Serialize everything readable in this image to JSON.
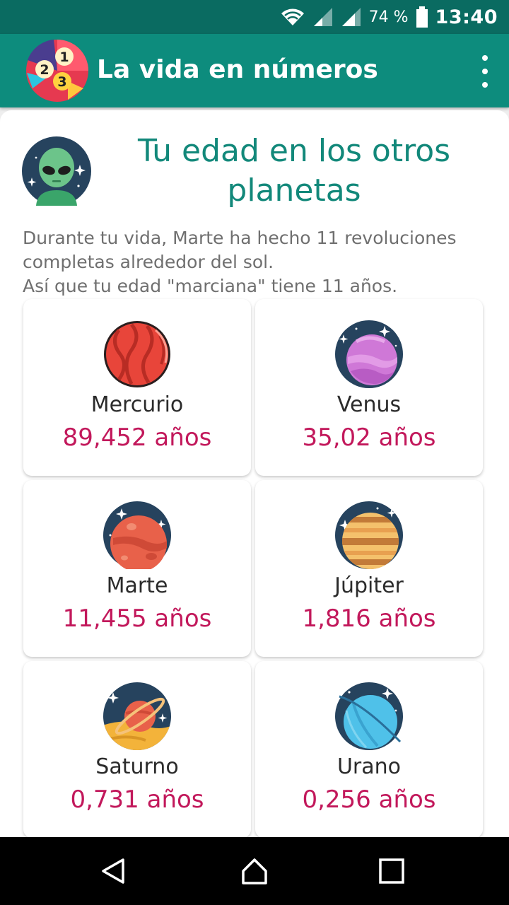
{
  "status_bar": {
    "battery_percent": "74 %",
    "time": "13:40",
    "icons": [
      "wifi-icon",
      "signal-icon",
      "signal-icon",
      "battery-icon"
    ]
  },
  "app_bar": {
    "title": "La vida en números",
    "logo_digits": [
      "1",
      "2",
      "3"
    ],
    "overflow_icon": "more-vert-icon"
  },
  "section": {
    "title": "Tu edad en los otros planetas",
    "description": "Durante tu vida, Marte ha hecho 11 revoluciones completas alrededor del sol.\n Así que tu edad \"marciana\" tiene 11 años."
  },
  "planets": [
    {
      "name": "Mercurio",
      "age": "89,452 años",
      "icon": "mercury-icon"
    },
    {
      "name": "Venus",
      "age": "35,02 años",
      "icon": "venus-icon"
    },
    {
      "name": "Marte",
      "age": "11,455 años",
      "icon": "mars-icon"
    },
    {
      "name": "Júpiter",
      "age": "1,816 años",
      "icon": "jupiter-icon"
    },
    {
      "name": "Saturno",
      "age": "0,731 años",
      "icon": "saturn-icon"
    },
    {
      "name": "Urano",
      "age": "0,256 años",
      "icon": "uranus-icon"
    }
  ],
  "nav_bar": {
    "buttons": [
      "back-icon",
      "home-icon",
      "recents-icon"
    ]
  },
  "colors": {
    "status_bar": "#0a6b61",
    "app_bar": "#0d8c7d",
    "title_teal": "#12887a",
    "age_magenta": "#c2185b"
  }
}
